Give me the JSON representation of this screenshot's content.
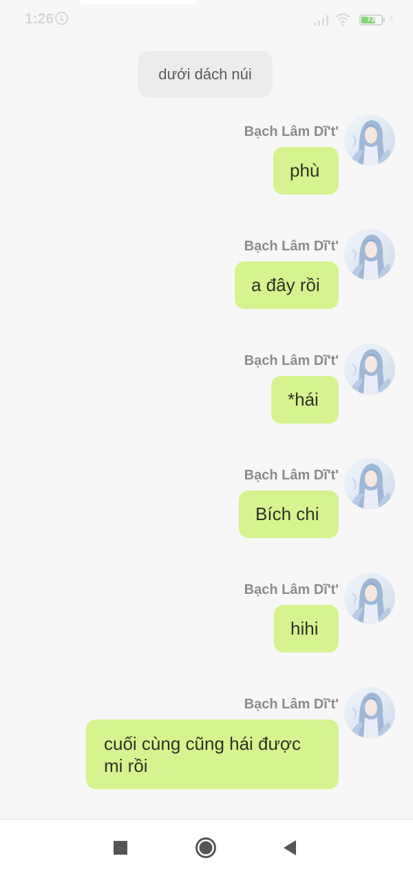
{
  "status_bar": {
    "time": "1:26",
    "battery_level": "73",
    "battery_fraction": 0.73,
    "icons": [
      "alarm-icon",
      "signal-icon",
      "wifi-icon",
      "battery-icon",
      "charging-icon"
    ]
  },
  "system_message": "dưới dách núi",
  "messages": [
    {
      "sender": "Bạch Lâm Dĩ't'",
      "text": "phù"
    },
    {
      "sender": "Bạch Lâm Dĩ't'",
      "text": "a đây rồi"
    },
    {
      "sender": "Bạch Lâm Dĩ't'",
      "text": "*hái"
    },
    {
      "sender": "Bạch Lâm Dĩ't'",
      "text": "Bích chi"
    },
    {
      "sender": "Bạch Lâm Dĩ't'",
      "text": "hihi"
    },
    {
      "sender": "Bạch Lâm Dĩ't'",
      "text": "cuối cùng cũng hái được mi rồi"
    }
  ],
  "nav": {
    "icons": [
      "recents-square-icon",
      "home-circle-icon",
      "back-triangle-icon"
    ]
  },
  "colors": {
    "background": "#f7f7f7",
    "bubble": "#d6f38f",
    "system_bubble": "#ececec",
    "sender_name": "#8b8b8b"
  }
}
